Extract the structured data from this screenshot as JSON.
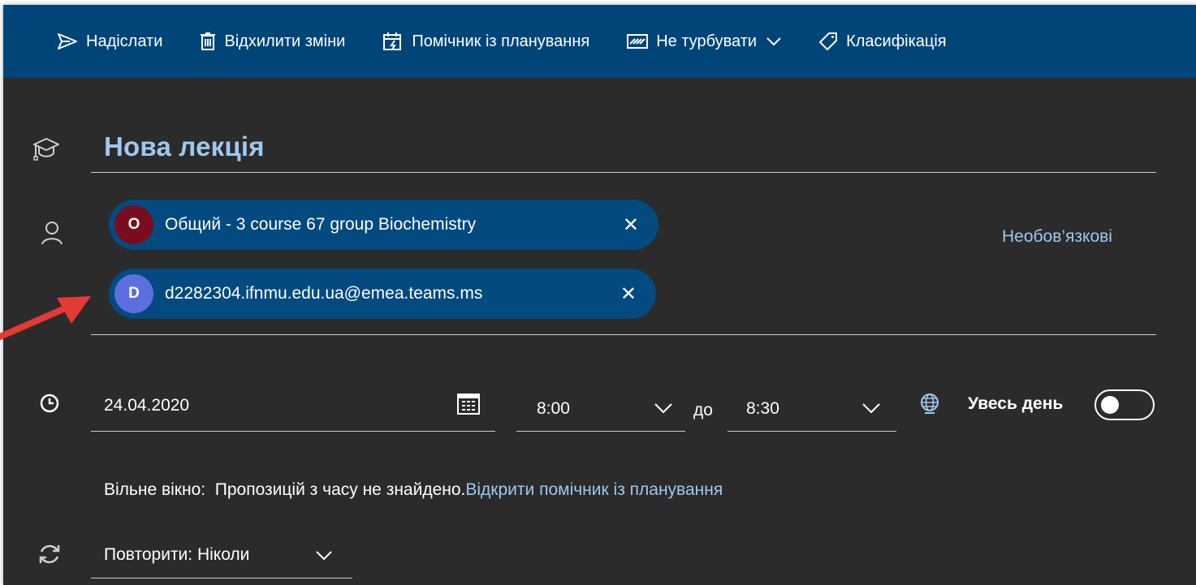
{
  "toolbar": {
    "send": "Надіслати",
    "discard": "Відхилити зміни",
    "scheduling": "Помічник із планування",
    "busy": "Не турбувати",
    "classify": "Класифікація"
  },
  "event": {
    "title": "Нова лекція",
    "optional_label": "Необов’язкові"
  },
  "attendees": [
    {
      "initial": "O",
      "name": "Общий - 3 course 67 group Biochemistry",
      "color": "#7a0c1f"
    },
    {
      "initial": "D",
      "name": "d2282304.ifnmu.edu.ua@emea.teams.ms",
      "color": "#5b6fe0"
    }
  ],
  "time": {
    "date": "24.04.2020",
    "start": "8:00",
    "to_label": "до",
    "end": "8:30",
    "allday_label": "Увесь день",
    "allday_on": false
  },
  "free_slot": {
    "label": "Вільне вікно:",
    "message": "Пропозицій з часу не знайдено.",
    "link": "Відкрити помічник із планування"
  },
  "repeat": {
    "label": "Повторити: Ніколи"
  },
  "colors": {
    "toolbar_bg": "#004578",
    "page_bg": "#2b2b2b",
    "accent": "#9fc8ef",
    "chip_bg": "#034a80",
    "arrow": "#e53935"
  }
}
